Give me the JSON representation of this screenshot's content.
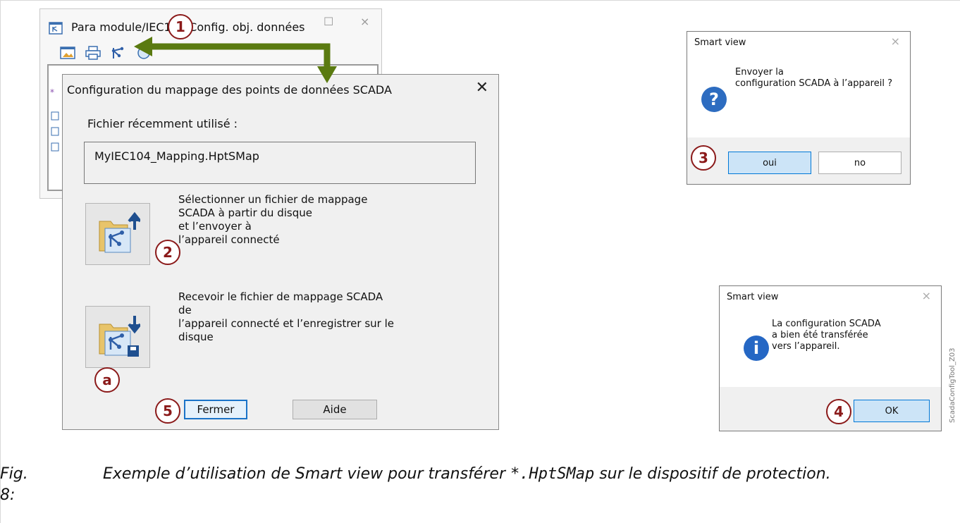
{
  "background_window": {
    "title": "Para module/IEC104 Config. obj. données",
    "controls": {
      "maximize": "☐",
      "close": "×"
    }
  },
  "main_dialog": {
    "title": "Configuration du mappage des points de données SCADA",
    "close_glyph": "✕",
    "recent_label": "Fichier récemment utilisé :",
    "recent_file": "MyIEC104_Mapping.HptSMap",
    "send_option_text": "Sélectionner un fichier de mappage\nSCADA à partir du disque\net l’envoyer à\nl’appareil connecté",
    "receive_option_text": "Recevoir le fichier de mappage SCADA\nde\nl’appareil connecté et l’enregistrer sur le\ndisque",
    "close_button": "Fermer",
    "help_button": "Aide"
  },
  "confirm_dialog": {
    "title": "Smart view",
    "close_glyph": "×",
    "icon_glyph": "?",
    "message": "Envoyer la\nconfiguration SCADA à l’appareil ?",
    "yes_button": "oui",
    "no_button": "no"
  },
  "info_dialog": {
    "title": "Smart view",
    "close_glyph": "×",
    "icon_glyph": "i",
    "message": "La configuration SCADA\na bien été transférée\nvers l’appareil.",
    "ok_button": "OK"
  },
  "callouts": {
    "one": "1",
    "two": "2",
    "three": "3",
    "four": "4",
    "five": "5",
    "a": "a"
  },
  "caption": {
    "number": "Fig. 8:",
    "text_before": "Exemple d’utilisation de Smart view pour transférer ",
    "code": "*.HptSMap",
    "text_after": " sur le dispositif de protection."
  },
  "side_label": "ScadaConfigTool_Z03",
  "colors": {
    "arrow": "#5a7a10",
    "callout": "#8b1a1a",
    "focus": "#1a73c8",
    "question_icon": "#2d6cc0",
    "info_icon": "#2567c4"
  }
}
